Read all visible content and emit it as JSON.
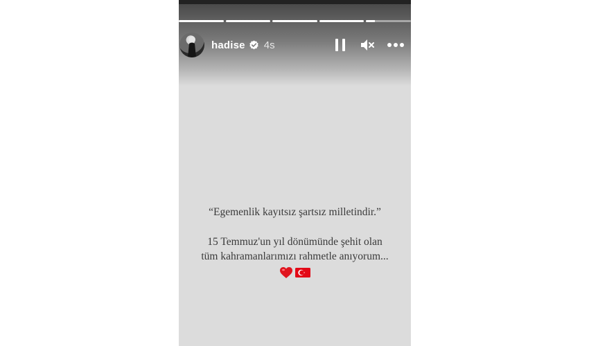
{
  "story": {
    "segments": [
      1,
      1,
      1,
      1,
      0.2
    ],
    "user": {
      "username": "hadise",
      "verified": true,
      "time": "4s"
    },
    "controls": [
      "pause-icon",
      "mute-icon",
      "more-icon"
    ],
    "text": {
      "quote": "“Egemenlik kayıtsız şartsız milletindir.”",
      "line1": "15 Temmuz'un yıl dönümünde şehit olan",
      "line2": "tüm kahramanlarımızı rahmetle anıyorum..."
    },
    "emojis": [
      "heart-icon",
      "turkish-flag-icon"
    ],
    "colors": {
      "background": "#dcdcdc",
      "text": "#3a3a3a",
      "heart": "#e0151f",
      "flag": "#e30a17"
    }
  }
}
